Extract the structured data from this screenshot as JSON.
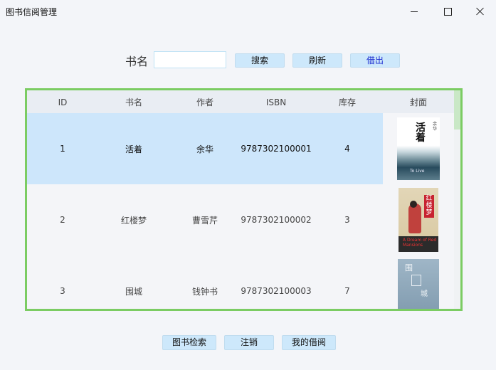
{
  "window": {
    "title": "图书信阅管理"
  },
  "search": {
    "label": "书名",
    "value": "",
    "placeholder": ""
  },
  "toolbar": {
    "search_label": "搜索",
    "refresh_label": "刷新",
    "borrow_label": "借出"
  },
  "table": {
    "columns": [
      "ID",
      "书名",
      "作者",
      "ISBN",
      "库存",
      "封面"
    ],
    "rows": [
      {
        "id": "1",
        "title": "活着",
        "author": "余华",
        "isbn": "9787302100001",
        "stock": "4",
        "selected": true
      },
      {
        "id": "2",
        "title": "红楼梦",
        "author": "曹雪芹",
        "isbn": "9787302100002",
        "stock": "3",
        "selected": false
      },
      {
        "id": "3",
        "title": "围城",
        "author": "钱钟书",
        "isbn": "9787302100003",
        "stock": "7",
        "selected": false
      }
    ]
  },
  "covers": {
    "c1_title": "活着",
    "c1_author": "余华",
    "c1_sub": "To Live",
    "c2_title": "红楼梦",
    "c2_sub": "A Dream of Red Mansions",
    "c3_title": "围",
    "c3_sub": "城"
  },
  "bottom": {
    "search_books": "图书检索",
    "logout": "注销",
    "my_borrowings": "我的借阅"
  },
  "colors": {
    "accent_border": "#7bcc63",
    "button_bg": "#cde8fb",
    "selected_row": "#cde6fb"
  }
}
